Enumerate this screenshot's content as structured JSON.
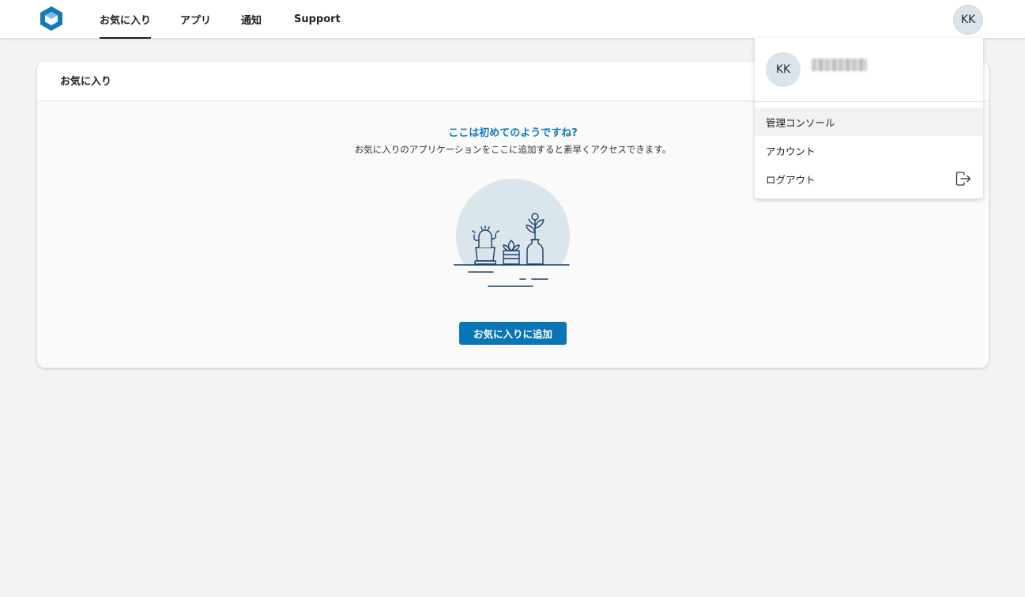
{
  "nav": {
    "tabs": [
      {
        "label": "お気に入り",
        "active": true
      },
      {
        "label": "アプリ",
        "active": false
      },
      {
        "label": "通知",
        "active": false
      },
      {
        "label": "Support",
        "active": false
      }
    ],
    "avatar_initials": "KK"
  },
  "card": {
    "title": "お気に入り",
    "empty_title": "ここは初めてのようですね?",
    "empty_description": "お気に入りのアプリケーションをここに追加すると素早くアクセスできます。",
    "add_button_label": "お気に入りに追加",
    "illustration_icon": "plants-on-shelf-illustration"
  },
  "user_menu": {
    "avatar_initials": "KK",
    "items": [
      {
        "label": "管理コンソール"
      },
      {
        "label": "アカウント"
      },
      {
        "label": "ログアウト",
        "icon": "logout-icon"
      }
    ]
  },
  "colors": {
    "accent": "#0875b4",
    "accent_text": "#1479b8",
    "avatar_bg": "#dae4ea",
    "page_bg": "#f3f3f3"
  }
}
